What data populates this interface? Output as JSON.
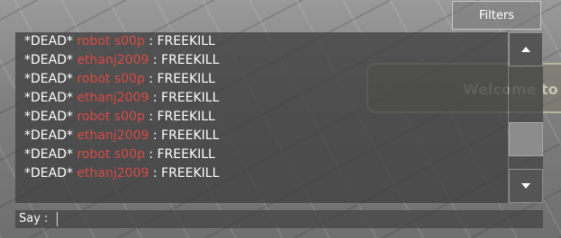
{
  "filters": {
    "label": "Filters"
  },
  "welcome": {
    "text": "Welcome to"
  },
  "chat": {
    "lines": [
      {
        "tag": "*DEAD*",
        "player": "robot s00p",
        "sep": " : ",
        "message": "FREEKILL"
      },
      {
        "tag": "*DEAD*",
        "player": "ethanj2009",
        "sep": " : ",
        "message": "FREEKILL"
      },
      {
        "tag": "*DEAD*",
        "player": "robot s00p",
        "sep": " : ",
        "message": "FREEKILL"
      },
      {
        "tag": "*DEAD*",
        "player": "ethanj2009",
        "sep": " : ",
        "message": "FREEKILL"
      },
      {
        "tag": "*DEAD*",
        "player": "robot s00p",
        "sep": " : ",
        "message": "FREEKILL"
      },
      {
        "tag": "*DEAD*",
        "player": "ethanj2009",
        "sep": " : ",
        "message": "FREEKILL"
      },
      {
        "tag": "*DEAD*",
        "player": "robot s00p",
        "sep": " : ",
        "message": "FREEKILL"
      },
      {
        "tag": "*DEAD*",
        "player": "ethanj2009",
        "sep": " : ",
        "message": "FREEKILL"
      }
    ]
  },
  "say": {
    "label": "Say :",
    "value": ""
  },
  "icons": {
    "scroll_up": "chevron-up-icon",
    "scroll_down": "chevron-down-icon"
  },
  "colors": {
    "player_name": "#d74a48",
    "text": "#ffffff"
  }
}
